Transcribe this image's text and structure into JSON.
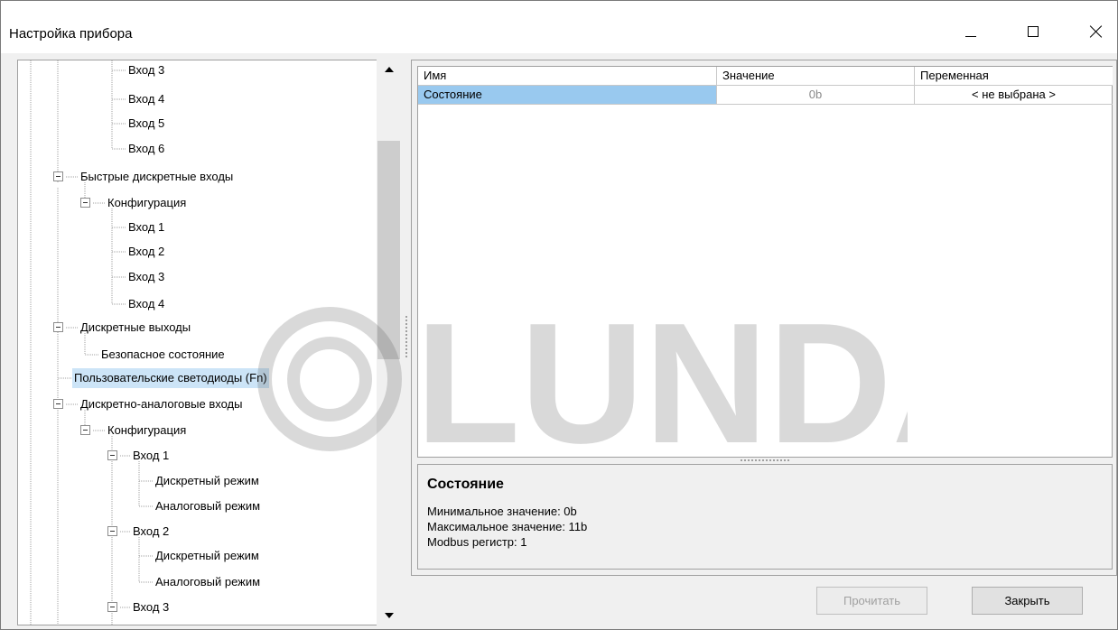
{
  "window": {
    "title": "Настройка прибора"
  },
  "tree": {
    "nodes": [
      {
        "label": "Вход 3"
      },
      {
        "label": "Вход 4"
      },
      {
        "label": "Вход 5"
      },
      {
        "label": "Вход 6"
      },
      {
        "label": "Быстрые дискретные входы"
      },
      {
        "label": "Конфигурация"
      },
      {
        "label": "Вход 1"
      },
      {
        "label": "Вход 2"
      },
      {
        "label": "Вход 3"
      },
      {
        "label": "Вход 4"
      },
      {
        "label": "Дискретные выходы"
      },
      {
        "label": "Безопасное состояние"
      },
      {
        "label": "Пользовательские светодиоды (Fn)",
        "selected": true
      },
      {
        "label": "Дискретно-аналоговые входы"
      },
      {
        "label": "Конфигурация"
      },
      {
        "label": "Вход 1"
      },
      {
        "label": "Дискретный режим"
      },
      {
        "label": "Аналоговый режим"
      },
      {
        "label": "Вход 2"
      },
      {
        "label": "Дискретный режим"
      },
      {
        "label": "Аналоговый режим"
      },
      {
        "label": "Вход 3"
      }
    ]
  },
  "grid": {
    "columns": [
      "Имя",
      "Значение",
      "Переменная"
    ],
    "rows": [
      {
        "name": "Состояние",
        "value": "0b",
        "variable": "< не выбрана >"
      }
    ]
  },
  "info": {
    "title": "Состояние",
    "min": "Минимальное значение: 0b",
    "max": "Максимальное значение: 11b",
    "modbus": "Modbus регистр: 1"
  },
  "buttons": {
    "read": "Прочитать",
    "close": "Закрыть"
  },
  "watermark": {
    "text": "LUNDA"
  },
  "colors": {
    "selection": "#99c9ef",
    "tree_selection": "#cce4f7"
  }
}
